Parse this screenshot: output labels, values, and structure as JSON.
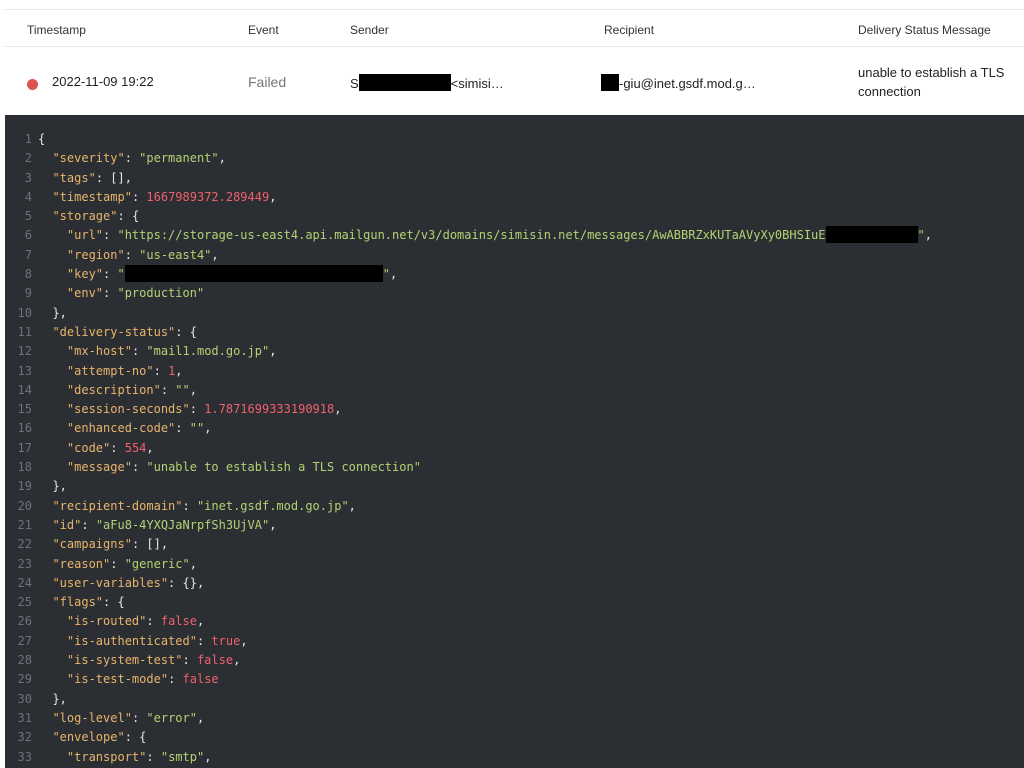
{
  "table": {
    "headers": {
      "timestamp": "Timestamp",
      "event": "Event",
      "sender": "Sender",
      "recipient": "Recipient",
      "message": "Delivery Status Message"
    },
    "row": {
      "timestamp": "2022-11-09 19:22",
      "event": "Failed",
      "sender_prefix": "S",
      "sender_suffix": "<simisi…",
      "recipient_suffix": "-giu@inet.gsdf.mod.g…",
      "message": "unable to establish a TLS connection",
      "status_color": "#d9534f"
    }
  },
  "code": {
    "lines": [
      {
        "n": "1",
        "text": "{"
      },
      {
        "n": "2",
        "key": "severity",
        "val": "\"permanent\"",
        "type": "s",
        "indent": 1,
        "trail": ","
      },
      {
        "n": "3",
        "key": "tags",
        "val": "[]",
        "type": "p",
        "indent": 1,
        "trail": ","
      },
      {
        "n": "4",
        "key": "timestamp",
        "val": "1667989372.289449",
        "type": "n",
        "indent": 1,
        "trail": ","
      },
      {
        "n": "5",
        "key": "storage",
        "val": "{",
        "type": "p",
        "indent": 1,
        "trail": ""
      },
      {
        "n": "6",
        "key": "url",
        "val": "\"https://storage-us-east4.api.mailgun.net/v3/domains/simisin.net/messages/AwABBRZxKUTaAVyXy0BHSIuE",
        "type": "s",
        "indent": 2,
        "trail": "\",",
        "redact_after": 95
      },
      {
        "n": "7",
        "key": "region",
        "val": "\"us-east4\"",
        "type": "s",
        "indent": 2,
        "trail": ","
      },
      {
        "n": "8",
        "key": "key",
        "val": "\"",
        "type": "s",
        "indent": 2,
        "trail": "\",",
        "redact_after": 258
      },
      {
        "n": "9",
        "key": "env",
        "val": "\"production\"",
        "type": "s",
        "indent": 2,
        "trail": ""
      },
      {
        "n": "10",
        "text": "  },"
      },
      {
        "n": "11",
        "key": "delivery-status",
        "val": "{",
        "type": "p",
        "indent": 1,
        "trail": ""
      },
      {
        "n": "12",
        "key": "mx-host",
        "val": "\"mail1.mod.go.jp\"",
        "type": "s",
        "indent": 2,
        "trail": ","
      },
      {
        "n": "13",
        "key": "attempt-no",
        "val": "1",
        "type": "n",
        "indent": 2,
        "trail": ","
      },
      {
        "n": "14",
        "key": "description",
        "val": "\"\"",
        "type": "s",
        "indent": 2,
        "trail": ","
      },
      {
        "n": "15",
        "key": "session-seconds",
        "val": "1.7871699333190918",
        "type": "n",
        "indent": 2,
        "trail": ","
      },
      {
        "n": "16",
        "key": "enhanced-code",
        "val": "\"\"",
        "type": "s",
        "indent": 2,
        "trail": ","
      },
      {
        "n": "17",
        "key": "code",
        "val": "554",
        "type": "n",
        "indent": 2,
        "trail": ","
      },
      {
        "n": "18",
        "key": "message",
        "val": "\"unable to establish a TLS connection\"",
        "type": "s",
        "indent": 2,
        "trail": ""
      },
      {
        "n": "19",
        "text": "  },"
      },
      {
        "n": "20",
        "key": "recipient-domain",
        "val": "\"inet.gsdf.mod.go.jp\"",
        "type": "s",
        "indent": 1,
        "trail": ","
      },
      {
        "n": "21",
        "key": "id",
        "val": "\"aFu8-4YXQJaNrpfSh3UjVA\"",
        "type": "s",
        "indent": 1,
        "trail": ","
      },
      {
        "n": "22",
        "key": "campaigns",
        "val": "[]",
        "type": "p",
        "indent": 1,
        "trail": ","
      },
      {
        "n": "23",
        "key": "reason",
        "val": "\"generic\"",
        "type": "s",
        "indent": 1,
        "trail": ","
      },
      {
        "n": "24",
        "key": "user-variables",
        "val": "{}",
        "type": "p",
        "indent": 1,
        "trail": ","
      },
      {
        "n": "25",
        "key": "flags",
        "val": "{",
        "type": "p",
        "indent": 1,
        "trail": ""
      },
      {
        "n": "26",
        "key": "is-routed",
        "val": "false",
        "type": "b",
        "indent": 2,
        "trail": ","
      },
      {
        "n": "27",
        "key": "is-authenticated",
        "val": "true",
        "type": "b",
        "indent": 2,
        "trail": ","
      },
      {
        "n": "28",
        "key": "is-system-test",
        "val": "false",
        "type": "b",
        "indent": 2,
        "trail": ","
      },
      {
        "n": "29",
        "key": "is-test-mode",
        "val": "false",
        "type": "b",
        "indent": 2,
        "trail": ""
      },
      {
        "n": "30",
        "text": "  },"
      },
      {
        "n": "31",
        "key": "log-level",
        "val": "\"error\"",
        "type": "s",
        "indent": 1,
        "trail": ","
      },
      {
        "n": "32",
        "key": "envelope",
        "val": "{",
        "type": "p",
        "indent": 1,
        "trail": ""
      },
      {
        "n": "33",
        "key": "transport",
        "val": "\"smtp\"",
        "type": "s",
        "indent": 2,
        "trail": ","
      }
    ]
  }
}
